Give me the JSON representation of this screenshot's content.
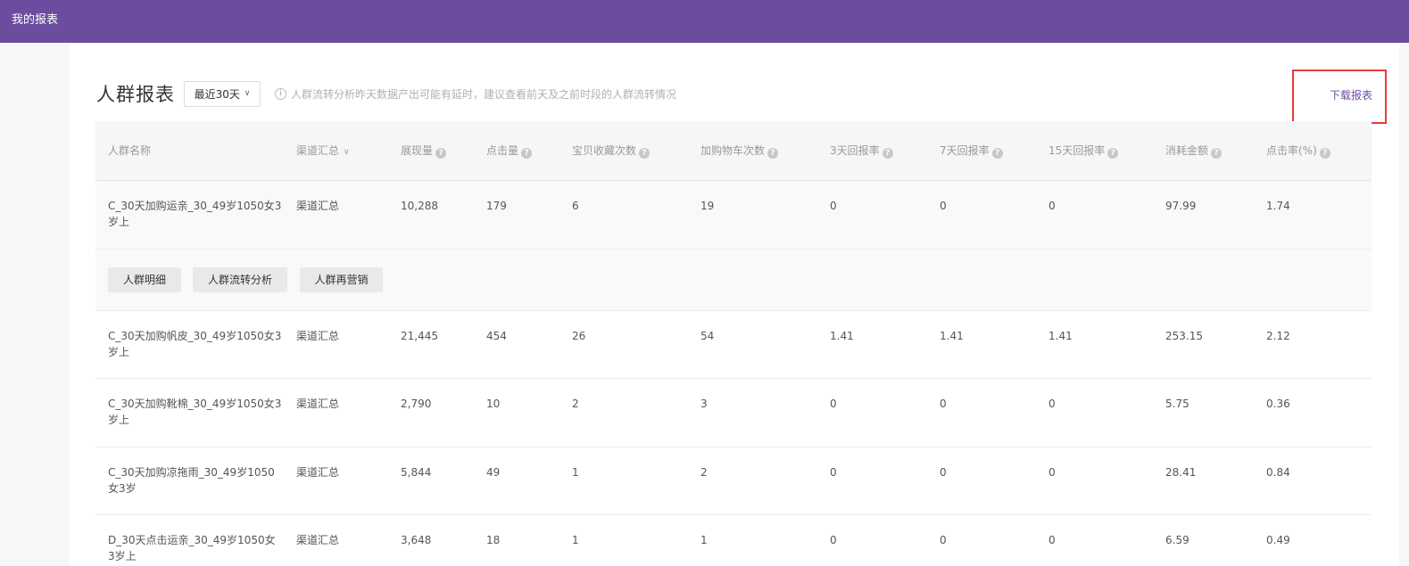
{
  "topbar": {
    "title": "我的报表"
  },
  "header": {
    "title": "人群报表",
    "range_label": "最近30天",
    "notice": "人群流转分析昨天数据产出可能有延时，建议查看前天及之前时段的人群流转情况",
    "download_label": "下载报表"
  },
  "table": {
    "columns": [
      "人群名称",
      "渠道汇总",
      "展现量",
      "点击量",
      "宝贝收藏次数",
      "加购物车次数",
      "3天回报率",
      "7天回报率",
      "15天回报率",
      "消耗金额",
      "点击率(%)"
    ],
    "rows": [
      [
        "C_30天加购运亲_30_49岁1050女3岁上",
        "渠道汇总",
        "10,288",
        "179",
        "6",
        "19",
        "0",
        "0",
        "0",
        "97.99",
        "1.74"
      ],
      [
        "C_30天加购帆皮_30_49岁1050女3岁上",
        "渠道汇总",
        "21,445",
        "454",
        "26",
        "54",
        "1.41",
        "1.41",
        "1.41",
        "253.15",
        "2.12"
      ],
      [
        "C_30天加购靴棉_30_49岁1050女3岁上",
        "渠道汇总",
        "2,790",
        "10",
        "2",
        "3",
        "0",
        "0",
        "0",
        "5.75",
        "0.36"
      ],
      [
        "C_30天加购凉拖雨_30_49岁1050女3岁",
        "渠道汇总",
        "5,844",
        "49",
        "1",
        "2",
        "0",
        "0",
        "0",
        "28.41",
        "0.84"
      ],
      [
        "D_30天点击运亲_30_49岁1050女3岁上",
        "渠道汇总",
        "3,648",
        "18",
        "1",
        "1",
        "0",
        "0",
        "0",
        "6.59",
        "0.49"
      ]
    ],
    "actions": [
      "人群明细",
      "人群流转分析",
      "人群再营销"
    ]
  }
}
